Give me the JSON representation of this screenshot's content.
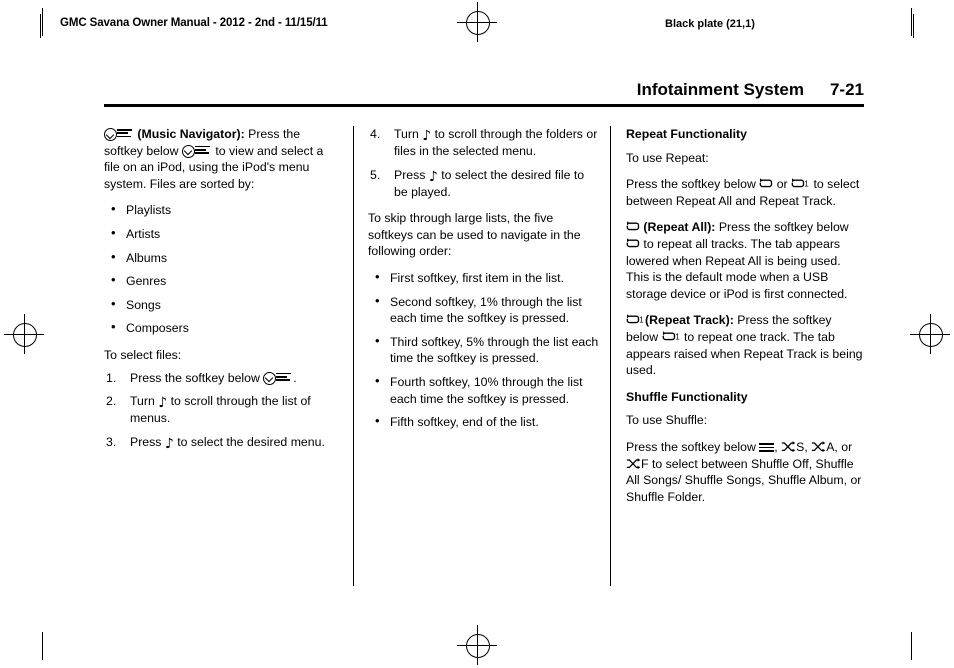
{
  "header": {
    "manual_title": "GMC Savana Owner Manual - 2012 - 2nd - 11/15/11",
    "black_plate": "Black plate (21,1)"
  },
  "running_head": {
    "section": "Infotainment System",
    "page": "7-21"
  },
  "column1": {
    "music_navigator": {
      "label": "(Music Navigator):",
      "text_1": "Press the softkey below",
      "text_2": "to view and select a file on an iPod, using the iPod's menu system. Files are sorted by:"
    },
    "sort_list": [
      "Playlists",
      "Artists",
      "Albums",
      "Genres",
      "Songs",
      "Composers"
    ],
    "select_files_intro": "To select files:",
    "steps": [
      {
        "pre": "Press the softkey below",
        "post": "."
      },
      {
        "pre": "Turn",
        "post": "to scroll through the list of menus."
      },
      {
        "pre": "Press",
        "post": "to select the desired menu."
      }
    ]
  },
  "column2": {
    "steps": [
      {
        "num": "4.",
        "pre": "Turn",
        "post": "to scroll through the folders or files in the selected menu."
      },
      {
        "num": "5.",
        "pre": "Press",
        "post": "to select the desired file to be played."
      }
    ],
    "skip_intro": "To skip through large lists, the five softkeys can be used to navigate in the following order:",
    "skip_list": [
      "First softkey, first item in the list.",
      "Second softkey, 1% through the list each time the softkey is pressed.",
      "Third softkey, 5% through the list each time the softkey is pressed.",
      "Fourth softkey, 10% through the list each time the softkey is pressed.",
      "Fifth softkey, end of the list."
    ]
  },
  "column3": {
    "repeat_heading": "Repeat Functionality",
    "repeat_intro": "To use Repeat:",
    "repeat_press_1": "Press the softkey below",
    "repeat_press_or": "or",
    "repeat_press_2": "to select between Repeat All and Repeat Track.",
    "repeat_all_label": "(Repeat All):",
    "repeat_all_text_1": "Press the softkey below",
    "repeat_all_text_2": "to repeat all tracks. The tab appears lowered when Repeat All is being used. This is the default mode when a USB storage device or iPod is first connected.",
    "repeat_track_label": "(Repeat Track):",
    "repeat_track_text_1": "Press the softkey below",
    "repeat_track_text_2": "to repeat one track. The tab appears raised when Repeat Track is being used.",
    "shuffle_heading": "Shuffle Functionality",
    "shuffle_intro": "To use Shuffle:",
    "shuffle_press_1": "Press the softkey below",
    "shuffle_sep_1": ",",
    "shuffle_label_s": "S",
    "shuffle_sep_2": ",",
    "shuffle_label_a": "A",
    "shuffle_or": ", or",
    "shuffle_label_f": "F",
    "shuffle_press_2": "to select between Shuffle Off, Shuffle All Songs/ Shuffle Songs, Shuffle Album, or Shuffle Folder."
  },
  "icons": {
    "music_navigator": "music-navigator-icon",
    "tune_knob": "musical-note-icon",
    "repeat_all": "repeat-all-icon",
    "repeat_track": "repeat-track-icon",
    "shuffle_off": "shuffle-off-icon",
    "shuffle": "shuffle-icon"
  }
}
